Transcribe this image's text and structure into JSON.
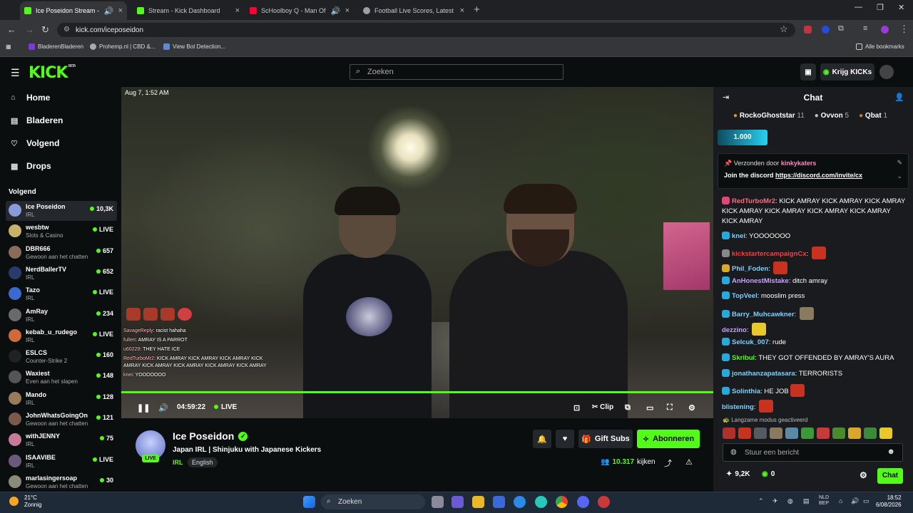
{
  "browser": {
    "tabs": [
      {
        "title": "Ice Poseidon Stream - Wat",
        "color": "#53fc18",
        "active": true
      },
      {
        "title": "Stream - Kick Dashboard",
        "color": "#53fc18",
        "active": false
      },
      {
        "title": "ScHoolboy Q - Man Of The",
        "color": "#ff0033",
        "active": false
      },
      {
        "title": "Football Live Scores, Latest Foo",
        "color": "#9aa0a6",
        "active": false
      }
    ],
    "url": "kick.com/iceposeidon",
    "bookmarks": [
      "BladerenBladeren",
      "Prohemp.nl | CBD &...",
      "View Bot Detection..."
    ],
    "all_bookmarks": "Alle bookmarks"
  },
  "header": {
    "logo": "KICK",
    "logo_badge": "BETA",
    "search_placeholder": "Zoeken",
    "kicks_button": "Krijg KICKs"
  },
  "sidebar": {
    "menu": [
      {
        "label": "Home",
        "icon": "⌂"
      },
      {
        "label": "Bladeren",
        "icon": "▤"
      },
      {
        "label": "Volgend",
        "icon": "♡"
      },
      {
        "label": "Drops",
        "icon": "▦"
      }
    ],
    "following_heading": "Volgend",
    "channels": [
      {
        "name": "Ice Poseidon",
        "category": "IRL",
        "viewers": "10,3K",
        "avatar": "#8a9ad8"
      },
      {
        "name": "wesbtw",
        "category": "Slots & Casino",
        "viewers": "LIVE",
        "avatar": "#c8b26a"
      },
      {
        "name": "DBR666",
        "category": "Gewoon aan het chatten",
        "viewers": "657",
        "avatar": "#8a6a5a"
      },
      {
        "name": "NerdBallerTV",
        "category": "IRL",
        "viewers": "652",
        "avatar": "#2a3a6a"
      },
      {
        "name": "Tazo",
        "category": "IRL",
        "viewers": "LIVE",
        "avatar": "#3a6ad0"
      },
      {
        "name": "AmRay",
        "category": "IRL",
        "viewers": "234",
        "avatar": "#6a6a6a"
      },
      {
        "name": "kebab_u_rudego",
        "category": "IRL",
        "viewers": "LIVE",
        "avatar": "#d06a3a"
      },
      {
        "name": "ESLCS",
        "category": "Counter-Strike 2",
        "viewers": "160",
        "avatar": "#222222"
      },
      {
        "name": "Waxiest",
        "category": "Even aan het slapen",
        "viewers": "148",
        "avatar": "#555555"
      },
      {
        "name": "Mando",
        "category": "IRL",
        "viewers": "128",
        "avatar": "#9a7a5a"
      },
      {
        "name": "JohnWhatsGoingOn",
        "category": "Gewoon aan het chatten",
        "viewers": "121",
        "avatar": "#7a5a4a"
      },
      {
        "name": "withJENNY",
        "category": "IRL",
        "viewers": "75",
        "avatar": "#c87a9a"
      },
      {
        "name": "ISAAVIBE",
        "category": "IRL",
        "viewers": "LIVE",
        "avatar": "#6a5a7a"
      },
      {
        "name": "marlasingersoap",
        "category": "Gewoon aan het chatten",
        "viewers": "30",
        "avatar": "#8a8a7a"
      }
    ]
  },
  "video": {
    "timestamp": "Aug 7, 1:52 AM",
    "overlay_chat": [
      {
        "user": "SavageReply",
        "text": "racist hahaha"
      },
      {
        "user": "fullert",
        "text": "AMRAY IS A PARROT"
      },
      {
        "user": "u60229",
        "text": "THEY HATE ICE"
      },
      {
        "user": "RedTurboMr2",
        "text": "KICK AMRAY KICK AMRAY KICK AMRAY KICK AMRAY KICK AMRAY KICK AMRAY KICK AMRAY KICK AMRAY"
      },
      {
        "user": "knei",
        "text": "YOOOOOOO"
      }
    ],
    "elapsed": "04:59:22",
    "live_label": "LIVE",
    "clip_label": "Clip",
    "progress": 1.0
  },
  "stream": {
    "name": "Ice Poseidon",
    "live_badge": "LIVE",
    "title": "Japan IRL | Shinjuku with Japanese Kickers",
    "category": "IRL",
    "language": "English",
    "gift_label": "Gift Subs",
    "subscribe_label": "Abonneren",
    "viewers": "10.317",
    "viewers_label": "kijken"
  },
  "chat": {
    "title": "Chat",
    "top_gifters": [
      {
        "name": "RockoGhoststar",
        "count": "11",
        "color": "#d4a017"
      },
      {
        "name": "Ovvon",
        "count": "5",
        "color": "#c0c0c0"
      },
      {
        "name": "Qbat",
        "count": "1",
        "color": "#cd7f32"
      }
    ],
    "goal": "1.000",
    "pinned_prefix": "Verzonden door",
    "pinned_user": "kinkykaters",
    "pinned_text": "Join the discord",
    "pinned_link": "https://discord.com/invite/cx",
    "messages": [
      {
        "user": "RedTurboMr2",
        "color": "#ff6b81",
        "badge": "#e0457b",
        "text": "KICK AMRAY KICK AMRAY KICK AMRAY KICK AMRAY KICK AMRAY KICK AMRAY KICK AMRAY KICK AMRAY",
        "emote": ""
      },
      {
        "user": "knei",
        "color": "#7ad3ff",
        "badge": "#2aa8d8",
        "text": "YOOOOOOO",
        "emote": ""
      },
      {
        "user": "kickstartercampaignCx",
        "color": "#ff3a3a",
        "badge": "#888888",
        "text": "",
        "emote": "#c8321e"
      },
      {
        "user": "Phil_Foden",
        "color": "#7ad3ff",
        "badge": "#d8a82a",
        "text": "",
        "emote": "#c8321e"
      },
      {
        "user": "AnHonestMistake",
        "color": "#c8a2ff",
        "badge": "#2aa8d8",
        "text": "ditch amray",
        "emote": ""
      },
      {
        "user": "TopVeel",
        "color": "#7ad3ff",
        "badge": "#2aa8d8",
        "text": "mooslim press",
        "emote": ""
      },
      {
        "user": "Barry_Muhcawkner",
        "color": "#7ad3ff",
        "badge": "#2aa8d8",
        "text": "",
        "emote": "#8a7a60"
      },
      {
        "user": "dezzino",
        "color": "#c8a2ff",
        "badge": "",
        "text": "",
        "emote": "#e8c82a"
      },
      {
        "user": "Selcuk_007",
        "color": "#7ad3ff",
        "badge": "#2aa8d8",
        "text": "rude",
        "emote": ""
      },
      {
        "user": "Skribul",
        "color": "#53fc18",
        "badge": "#2aa8d8",
        "text": "THEY GOT OFFENDED BY AMRAY'S AURA",
        "emote": ""
      },
      {
        "user": "jonathanzapatasara",
        "color": "#7ad3ff",
        "badge": "#2aa8d8",
        "text": "TERRORISTS",
        "emote": ""
      },
      {
        "user": "Solinthia",
        "color": "#7ad3ff",
        "badge": "#2aa8d8",
        "text": "HE JOB",
        "emote": "#c8321e"
      },
      {
        "user": "blistening",
        "color": "#7ad3ff",
        "badge": "",
        "text": "",
        "emote": "#c8321e"
      }
    ],
    "slow_mode": "Langzame modus geactiveerd",
    "input_placeholder": "Stuur een bericht",
    "kicks_count": "9,2K",
    "points": "0",
    "send_label": "Chat"
  },
  "taskbar": {
    "temp": "21°C",
    "weather": "Zonnig",
    "search": "Zoeken",
    "lang": "NLD",
    "lang2": "BEP",
    "time": "18:52",
    "date": "6/08/2026"
  }
}
